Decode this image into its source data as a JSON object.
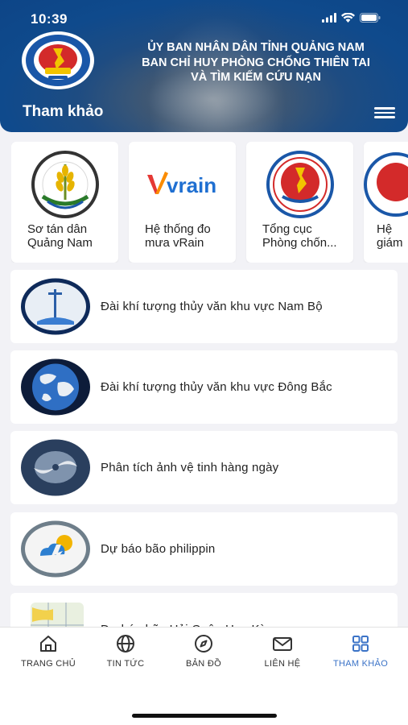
{
  "status_bar": {
    "time": "10:39"
  },
  "header": {
    "org_lines": [
      "ỦY BAN NHÂN DÂN TỈNH QUẢNG NAM",
      "BAN CHỈ HUY PHÒNG CHỐNG THIÊN TAI",
      "VÀ TÌM KIẾM CỨU NẠN"
    ],
    "section_title": "Tham khảo",
    "emblem_icon": "province-emblem-icon"
  },
  "cards": [
    {
      "line1": "Sơ tán dân",
      "line2": "Quảng Nam",
      "icon": "agriculture-wheat-icon"
    },
    {
      "line1": "Hệ thống đo",
      "line2": "mưa vRain",
      "icon": "vrain-logo-icon",
      "logo_text": "vrain"
    },
    {
      "line1": "Tổng cục",
      "line2": "Phòng chốn...",
      "icon": "disaster-prevention-emblem-icon"
    },
    {
      "line1": "Hệ",
      "line2": "giám",
      "icon": "emblem-icon"
    }
  ],
  "list": [
    {
      "label": "Đài khí tượng thủy văn khu vực Nam Bộ",
      "icon": "weather-station-icon"
    },
    {
      "label": "Đài khí tượng thủy văn khu vực Đông Bắc",
      "icon": "globe-icon"
    },
    {
      "label": "Phân tích ảnh vệ tinh hàng ngày",
      "icon": "satellite-typhoon-icon"
    },
    {
      "label": "Dự báo bão philippin",
      "icon": "weather-forecast-icon"
    },
    {
      "label": "Dự báo bão Hải Quân Hoa Kỳ",
      "icon": "storm-map-icon"
    }
  ],
  "tabbar": {
    "tabs": [
      {
        "label": "TRANG CHỦ",
        "icon": "home-icon"
      },
      {
        "label": "TIN TỨC",
        "icon": "globe-icon"
      },
      {
        "label": "BẢN ĐỒ",
        "icon": "compass-icon"
      },
      {
        "label": "LIÊN HỆ",
        "icon": "mail-icon"
      },
      {
        "label": "THAM KHẢO",
        "icon": "grid-icon"
      }
    ],
    "active_index": 4,
    "active_color": "#3b73c7"
  }
}
